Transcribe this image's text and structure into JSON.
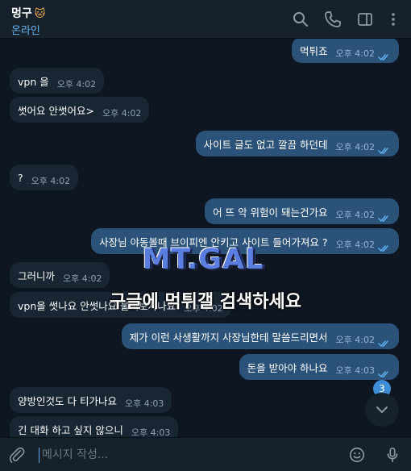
{
  "header": {
    "chat_name": "멍구",
    "emoji_icon": "cat-face-icon",
    "status": "온라인",
    "icons": [
      "search-icon",
      "phone-icon",
      "sidebar-toggle-icon",
      "more-vertical-icon"
    ]
  },
  "messages": [
    {
      "dir": "out",
      "text": "먹튀죠",
      "time": "오후 4:02",
      "read": true
    },
    {
      "dir": "in",
      "text": "vpn 을",
      "time": "오후 4:02"
    },
    {
      "dir": "in",
      "text": "썻어요 안썻어요>",
      "time": "오후 4:02"
    },
    {
      "dir": "out",
      "text": "사이트 글도 없고 깔끔 하던데",
      "time": "오후 4:02",
      "read": true
    },
    {
      "dir": "in",
      "text": "?",
      "time": "오후 4:02"
    },
    {
      "dir": "out",
      "text": "어 뜨 악 위험이 돼는건가요",
      "time": "오후 4:02",
      "read": true
    },
    {
      "dir": "out",
      "text": "사장님 야동볼때 브이피엔 안키고 사이트 들어가져요 ?",
      "time": "오후 4:02",
      "read": true
    },
    {
      "dir": "in",
      "text": "그러니까",
      "time": "오후 4:02"
    },
    {
      "dir": "in",
      "text": "vpn을 썻나요 안썻나요 물어보자나요",
      "time": "오후 4:02"
    },
    {
      "dir": "out",
      "text": "제가 이런 사생활까지 사장님한테 말씀드리면서",
      "time": "오후 4:02",
      "read": true
    },
    {
      "dir": "out",
      "text": "돈을 받아야 하나요",
      "time": "오후 4:03",
      "read": true
    },
    {
      "dir": "in",
      "text": "양방인것도 다 티가나요",
      "time": "오후 4:03"
    },
    {
      "dir": "in",
      "text": "긴 대화 하고 싶지 않으니",
      "time": "오후 4:03"
    }
  ],
  "watermark": {
    "logo": "MT.GAL",
    "caption": "구글에 먹튀갤 검색하세요"
  },
  "scroll": {
    "unread_count": "3",
    "icon": "chevron-down-icon"
  },
  "composer": {
    "placeholder": "메시지 작성...",
    "icons": [
      "attach-icon",
      "emoji-icon",
      "microphone-icon"
    ]
  },
  "colors": {
    "background": "#0e1621",
    "header": "#17212b",
    "incoming_bubble": "#182533",
    "outgoing_bubble": "#2b5278",
    "accent": "#64b5ef",
    "badge": "#3e8dd6"
  }
}
